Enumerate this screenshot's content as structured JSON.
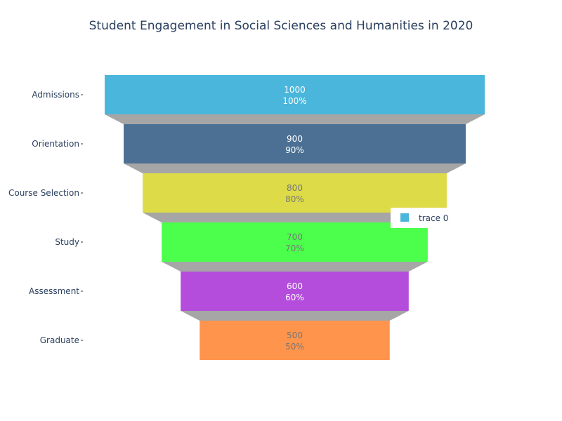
{
  "chart_data": {
    "type": "funnel",
    "title": "Student Engagement in Social Sciences and Humanities in 2020",
    "categories": [
      "Admissions",
      "Orientation",
      "Course Selection",
      "Study",
      "Assessment",
      "Graduate"
    ],
    "series": [
      {
        "name": "trace 0",
        "values": [
          1000,
          900,
          800,
          700,
          600,
          500
        ],
        "percent_labels": [
          "100%",
          "90%",
          "80%",
          "70%",
          "60%",
          "50%"
        ],
        "colors": [
          "#4bb6db",
          "#4c7093",
          "#dddb48",
          "#4cff4c",
          "#b44ddb",
          "#ff944c"
        ],
        "label_colors": [
          "#ffffff",
          "#ffffff",
          "#777777",
          "#777777",
          "#ffffff",
          "#777777"
        ]
      }
    ],
    "connector_color": "#a6a6a6",
    "legend": {
      "position": "right",
      "entries": [
        "trace 0"
      ]
    }
  }
}
